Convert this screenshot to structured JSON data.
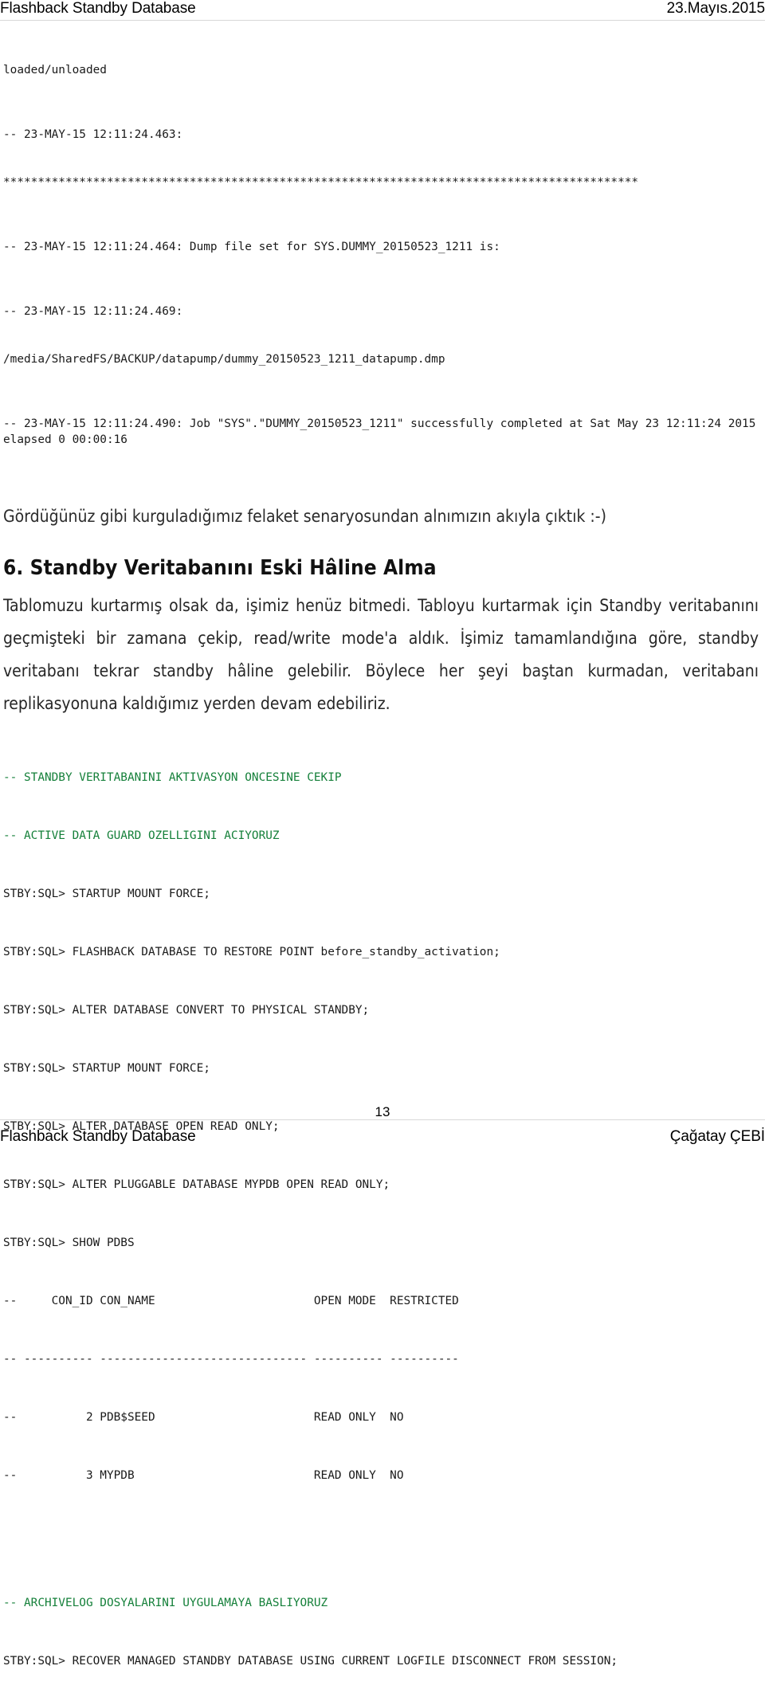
{
  "header": {
    "left_title": "Flashback Standby Database",
    "date": "23.Mayıs.2015"
  },
  "log_block": {
    "lines": [
      "loaded/unloaded",
      "-- 23-MAY-15 12:11:24.463:",
      "********************************************************************************************",
      "-- 23-MAY-15 12:11:24.464: Dump file set for SYS.DUMMY_20150523_1211 is:",
      "-- 23-MAY-15 12:11:24.469:",
      "/media/SharedFS/BACKUP/datapump/dummy_20150523_1211_datapump.dmp",
      "-- 23-MAY-15 12:11:24.490: Job \"SYS\".\"DUMMY_20150523_1211\" successfully completed at Sat May 23 12:11:24 2015 elapsed 0 00:00:16"
    ]
  },
  "intro_line": "Gördüğünüz gibi kurguladığımız felaket senaryosundan alnımızın akıyla çıktık :-)",
  "section": {
    "title": "6. Standby Veritabanını Eski Hâline Alma",
    "paragraph": "Tablomuzu kurtarmış olsak da, işimiz henüz bitmedi. Tabloyu kurtarmak için Standby veritabanını geçmişteki bir zamana çekip, read/write mode'a aldık. İşimiz tamamlandığına göre, standby veritabanı tekrar standby hâline gelebilir. Böylece her şeyi baştan kurmadan, veritabanı replikasyonuna kaldığımız yerden devam edebiliriz."
  },
  "sql_block": {
    "lines": [
      {
        "text": "-- STANDBY VERITABANINI AKTIVASYON ONCESINE CEKIP",
        "comment": true
      },
      {
        "text": "-- ACTIVE DATA GUARD OZELLIGINI ACIYORUZ",
        "comment": true
      },
      {
        "text": "STBY:SQL> STARTUP MOUNT FORCE;",
        "comment": false
      },
      {
        "text": "STBY:SQL> FLASHBACK DATABASE TO RESTORE POINT before_standby_activation;",
        "comment": false
      },
      {
        "text": "STBY:SQL> ALTER DATABASE CONVERT TO PHYSICAL STANDBY;",
        "comment": false
      },
      {
        "text": "STBY:SQL> STARTUP MOUNT FORCE;",
        "comment": false
      },
      {
        "text": "STBY:SQL> ALTER DATABASE OPEN READ ONLY;",
        "comment": false
      },
      {
        "text": "STBY:SQL> ALTER PLUGGABLE DATABASE MYPDB OPEN READ ONLY;",
        "comment": false
      },
      {
        "text": "STBY:SQL> SHOW PDBS",
        "comment": false
      },
      {
        "text": "--     CON_ID CON_NAME                       OPEN MODE  RESTRICTED",
        "comment": false
      },
      {
        "text": "-- ---------- ------------------------------ ---------- ----------",
        "comment": false
      },
      {
        "text": "--          2 PDB$SEED                       READ ONLY  NO",
        "comment": false
      },
      {
        "text": "--          3 MYPDB                          READ ONLY  NO",
        "comment": false
      }
    ]
  },
  "sql_block_tail": {
    "lines": [
      {
        "text": "-- ARCHIVELOG DOSYALARINI UYGULAMAYA BASLIYORUZ",
        "comment": true
      },
      {
        "text": "STBY:SQL> RECOVER MANAGED STANDBY DATABASE USING CURRENT LOGFILE DISCONNECT FROM SESSION;",
        "comment": false
      }
    ]
  },
  "footer": {
    "left_title": "Flashback Standby Database",
    "page_number": "13",
    "author": "Çağatay ÇEBİ"
  },
  "colors": {
    "comment_green": "#15803a",
    "text": "#1a1a1a",
    "rule": "#d8d8d8"
  }
}
